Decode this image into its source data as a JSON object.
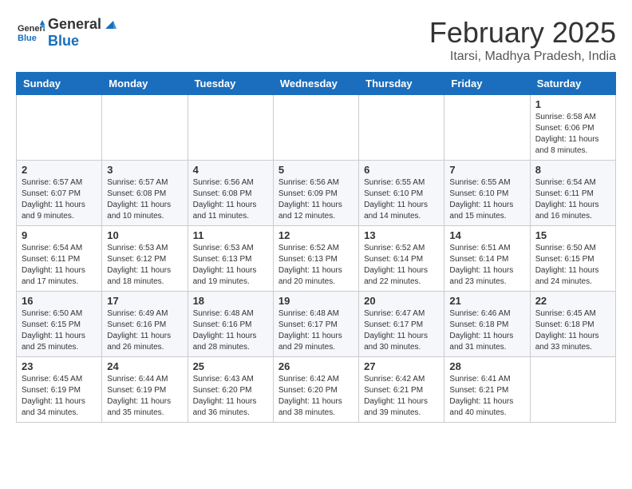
{
  "header": {
    "logo_general": "General",
    "logo_blue": "Blue",
    "month_title": "February 2025",
    "location": "Itarsi, Madhya Pradesh, India"
  },
  "weekdays": [
    "Sunday",
    "Monday",
    "Tuesday",
    "Wednesday",
    "Thursday",
    "Friday",
    "Saturday"
  ],
  "weeks": [
    [
      {
        "day": "",
        "info": ""
      },
      {
        "day": "",
        "info": ""
      },
      {
        "day": "",
        "info": ""
      },
      {
        "day": "",
        "info": ""
      },
      {
        "day": "",
        "info": ""
      },
      {
        "day": "",
        "info": ""
      },
      {
        "day": "1",
        "info": "Sunrise: 6:58 AM\nSunset: 6:06 PM\nDaylight: 11 hours and 8 minutes."
      }
    ],
    [
      {
        "day": "2",
        "info": "Sunrise: 6:57 AM\nSunset: 6:07 PM\nDaylight: 11 hours and 9 minutes."
      },
      {
        "day": "3",
        "info": "Sunrise: 6:57 AM\nSunset: 6:08 PM\nDaylight: 11 hours and 10 minutes."
      },
      {
        "day": "4",
        "info": "Sunrise: 6:56 AM\nSunset: 6:08 PM\nDaylight: 11 hours and 11 minutes."
      },
      {
        "day": "5",
        "info": "Sunrise: 6:56 AM\nSunset: 6:09 PM\nDaylight: 11 hours and 12 minutes."
      },
      {
        "day": "6",
        "info": "Sunrise: 6:55 AM\nSunset: 6:10 PM\nDaylight: 11 hours and 14 minutes."
      },
      {
        "day": "7",
        "info": "Sunrise: 6:55 AM\nSunset: 6:10 PM\nDaylight: 11 hours and 15 minutes."
      },
      {
        "day": "8",
        "info": "Sunrise: 6:54 AM\nSunset: 6:11 PM\nDaylight: 11 hours and 16 minutes."
      }
    ],
    [
      {
        "day": "9",
        "info": "Sunrise: 6:54 AM\nSunset: 6:11 PM\nDaylight: 11 hours and 17 minutes."
      },
      {
        "day": "10",
        "info": "Sunrise: 6:53 AM\nSunset: 6:12 PM\nDaylight: 11 hours and 18 minutes."
      },
      {
        "day": "11",
        "info": "Sunrise: 6:53 AM\nSunset: 6:13 PM\nDaylight: 11 hours and 19 minutes."
      },
      {
        "day": "12",
        "info": "Sunrise: 6:52 AM\nSunset: 6:13 PM\nDaylight: 11 hours and 20 minutes."
      },
      {
        "day": "13",
        "info": "Sunrise: 6:52 AM\nSunset: 6:14 PM\nDaylight: 11 hours and 22 minutes."
      },
      {
        "day": "14",
        "info": "Sunrise: 6:51 AM\nSunset: 6:14 PM\nDaylight: 11 hours and 23 minutes."
      },
      {
        "day": "15",
        "info": "Sunrise: 6:50 AM\nSunset: 6:15 PM\nDaylight: 11 hours and 24 minutes."
      }
    ],
    [
      {
        "day": "16",
        "info": "Sunrise: 6:50 AM\nSunset: 6:15 PM\nDaylight: 11 hours and 25 minutes."
      },
      {
        "day": "17",
        "info": "Sunrise: 6:49 AM\nSunset: 6:16 PM\nDaylight: 11 hours and 26 minutes."
      },
      {
        "day": "18",
        "info": "Sunrise: 6:48 AM\nSunset: 6:16 PM\nDaylight: 11 hours and 28 minutes."
      },
      {
        "day": "19",
        "info": "Sunrise: 6:48 AM\nSunset: 6:17 PM\nDaylight: 11 hours and 29 minutes."
      },
      {
        "day": "20",
        "info": "Sunrise: 6:47 AM\nSunset: 6:17 PM\nDaylight: 11 hours and 30 minutes."
      },
      {
        "day": "21",
        "info": "Sunrise: 6:46 AM\nSunset: 6:18 PM\nDaylight: 11 hours and 31 minutes."
      },
      {
        "day": "22",
        "info": "Sunrise: 6:45 AM\nSunset: 6:18 PM\nDaylight: 11 hours and 33 minutes."
      }
    ],
    [
      {
        "day": "23",
        "info": "Sunrise: 6:45 AM\nSunset: 6:19 PM\nDaylight: 11 hours and 34 minutes."
      },
      {
        "day": "24",
        "info": "Sunrise: 6:44 AM\nSunset: 6:19 PM\nDaylight: 11 hours and 35 minutes."
      },
      {
        "day": "25",
        "info": "Sunrise: 6:43 AM\nSunset: 6:20 PM\nDaylight: 11 hours and 36 minutes."
      },
      {
        "day": "26",
        "info": "Sunrise: 6:42 AM\nSunset: 6:20 PM\nDaylight: 11 hours and 38 minutes."
      },
      {
        "day": "27",
        "info": "Sunrise: 6:42 AM\nSunset: 6:21 PM\nDaylight: 11 hours and 39 minutes."
      },
      {
        "day": "28",
        "info": "Sunrise: 6:41 AM\nSunset: 6:21 PM\nDaylight: 11 hours and 40 minutes."
      },
      {
        "day": "",
        "info": ""
      }
    ]
  ]
}
